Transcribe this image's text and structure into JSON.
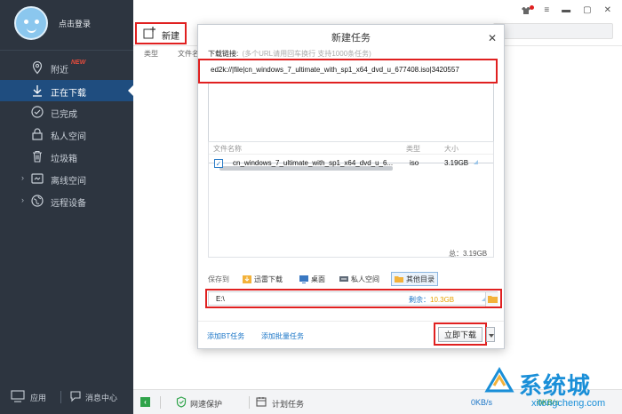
{
  "sidebar": {
    "login": "点击登录",
    "items": [
      {
        "label": "附近",
        "badge": "NEW"
      },
      {
        "label": "正在下载"
      },
      {
        "label": "已完成"
      },
      {
        "label": "私人空间"
      },
      {
        "label": "垃圾箱"
      },
      {
        "label": "离线空间"
      },
      {
        "label": "远程设备"
      }
    ],
    "bottom": {
      "apps": "应用",
      "messages": "消息中心"
    }
  },
  "toolbar": {
    "new_label": "新建"
  },
  "columns": {
    "type": "类型",
    "file": "文件名"
  },
  "dialog": {
    "title": "新建任务",
    "link_label": "下载链接:",
    "link_hint": "(多个URL请用回车换行  支持1000条任务)",
    "link_value": "ed2k://|file|cn_windows_7_ultimate_with_sp1_x64_dvd_u_677408.iso|3420557",
    "file_list": {
      "headers": [
        "文件名称",
        "类型",
        "大小"
      ],
      "rows": [
        {
          "name": "cn_windows_7_ultimate_with_sp1_x64_dvd_u_6...",
          "type": "iso",
          "size": "3.19GB",
          "checked": true
        }
      ],
      "total": "总：3.19GB"
    },
    "save_to": {
      "label": "保存到",
      "options": [
        "迅雷下载",
        "桌面",
        "私人空间",
        "其他目录"
      ],
      "selected": "其他目录"
    },
    "path": {
      "value": "E:\\",
      "free_label": "剩余：",
      "free_value": "10.3GB"
    },
    "add_bt": "添加BT任务",
    "add_batch": "添加批量任务",
    "download_button": "立即下载"
  },
  "bottombar": {
    "net_protect": "网速保护",
    "scheduled": "计划任务",
    "speed_down": "0KB/s",
    "speed_up": "0KB/s"
  },
  "watermark": {
    "title": "系统城",
    "sub": "xitongcheng.com"
  },
  "colors": {
    "sidebar": "#2d3540",
    "active": "#1f4d7f",
    "highlight": "#e02020",
    "link": "#1a75c7"
  }
}
